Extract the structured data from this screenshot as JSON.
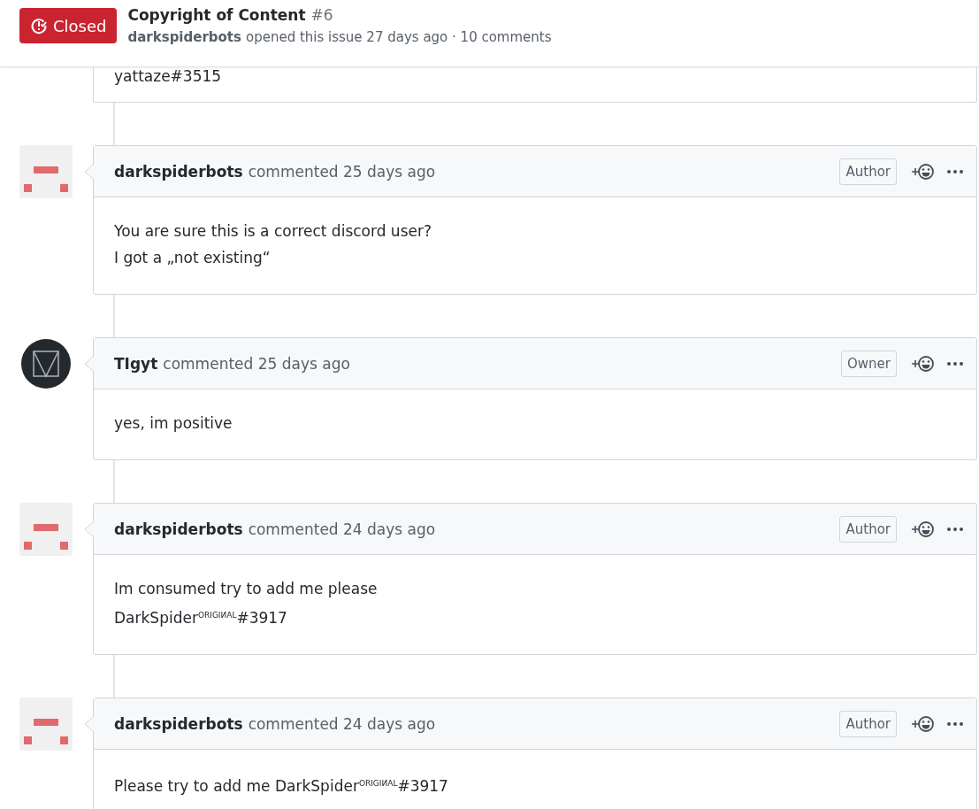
{
  "issue": {
    "state": "Closed",
    "title": "Copyright of Content",
    "number": "#6",
    "author": "darkspiderbots",
    "meta": "opened this issue 27 days ago · 10 comments"
  },
  "partial_comment": {
    "lines": [
      "yattaze#3515"
    ]
  },
  "comments": [
    {
      "kind": "identicon",
      "author": "darkspiderbots",
      "action": "commented 25 days ago",
      "badge": "Author",
      "lines": [
        "You are sure this is a correct discord user?",
        "I got a „not existing“"
      ]
    },
    {
      "kind": "logo",
      "author": "TIgyt",
      "action": "commented 25 days ago",
      "badge": "Owner",
      "lines": [
        "yes, im positive"
      ]
    },
    {
      "kind": "identicon",
      "author": "darkspiderbots",
      "action": "commented 24 days ago",
      "badge": "Author",
      "lines": [
        "Im consumed try to add me please",
        "DarkSpider$^{ORIGIИAL}$#3917"
      ]
    },
    {
      "kind": "identicon",
      "author": "darkspiderbots",
      "action": "commented 24 days ago",
      "badge": "Author",
      "lines": [
        "Please try to add me DarkSpider$^{ORIGIИAL}$#3917"
      ]
    }
  ]
}
